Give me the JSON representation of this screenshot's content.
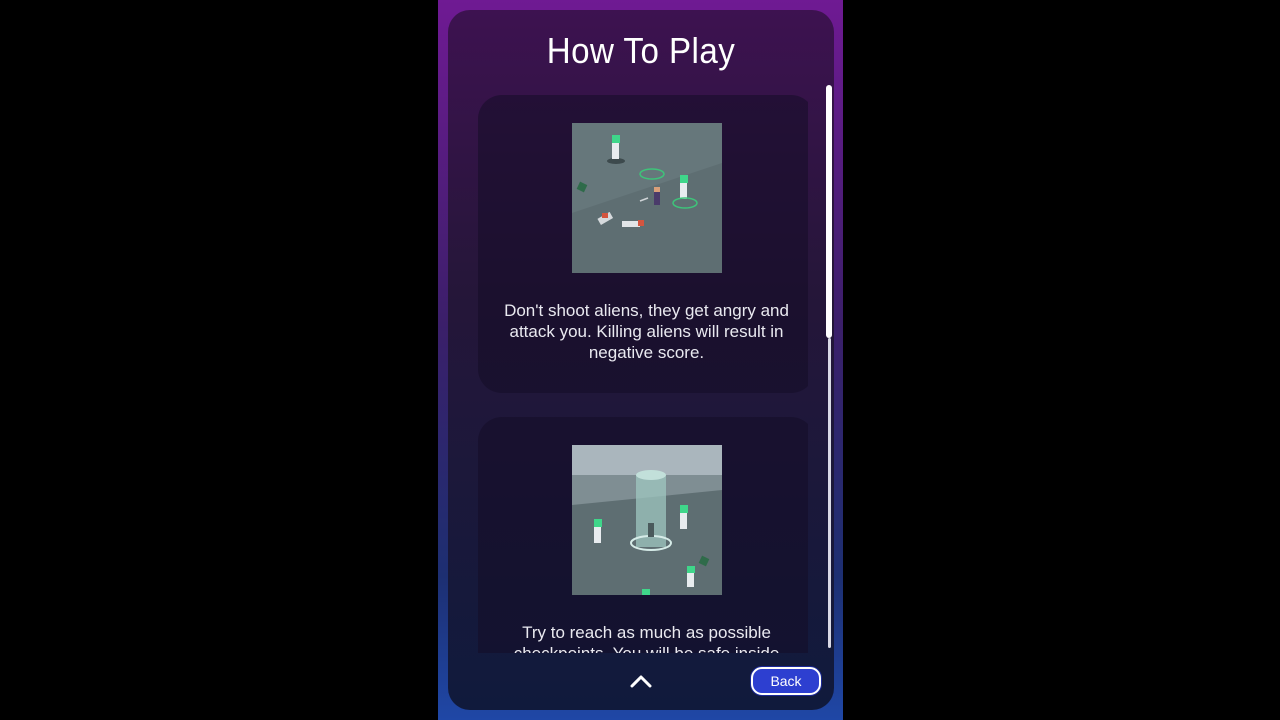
{
  "screen": {
    "title": "How To Play"
  },
  "cards": [
    {
      "text": "Don't shoot aliens, they get angry and attack you. Killing aliens will result in negative score."
    },
    {
      "text": "Try to reach as much as possible checkpoints. You will be safe inside"
    }
  ],
  "footer": {
    "back_label": "Back",
    "up_icon": "chevron-up-icon"
  },
  "colors": {
    "gradient_top": "#6f1a93",
    "gradient_bottom": "#1f47a6",
    "back_button": "#2d3fd0"
  }
}
